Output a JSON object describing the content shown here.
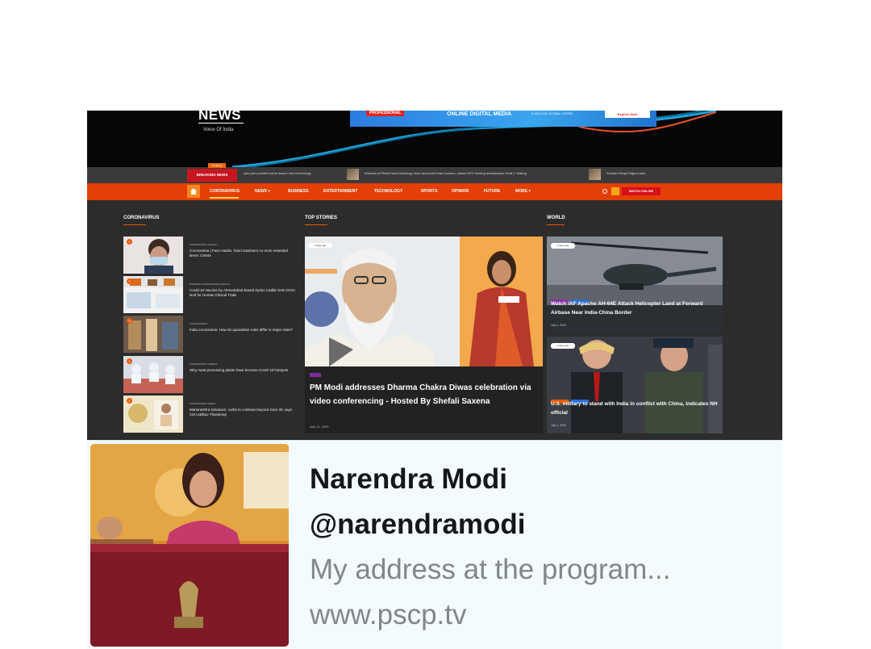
{
  "site": {
    "title": "NEWS",
    "tagline": "Voice Of India"
  },
  "ad": {
    "badge": "PROFESSIONAL",
    "headline": "ONLINE DIGITAL MEDIA",
    "sub": "5 MILLION GLOBAL USERS",
    "button": "Explore Now"
  },
  "breaking": {
    "label": "BREAKING NEWS",
    "flag": "Breaking",
    "items": [
      "ople just unveiled some insane new technology",
      "Wizards at Planet had technology more advanced than humans, claims UFO hunting ambassador Scott C Waring",
      "Sushant Singh Rajput case"
    ]
  },
  "nav": {
    "items": [
      "CORONAVIRUS",
      "NEWS ▾",
      "BUSINESS",
      "ENTERTAINMENT",
      "TECHNOLOGY",
      "SPORTS",
      "OPINION",
      "FUTURE",
      "MORE ▾"
    ],
    "watch_online": "WATCH ONLINE",
    "colors": {
      "bar": "#e43f06",
      "accent": "#ffd24a",
      "watch": "#d80f1a"
    }
  },
  "sections": {
    "coronavirus": "CORONAVIRUS",
    "top_stories": "TOP STORIES",
    "world": "WORLD"
  },
  "corona_items": [
    {
      "num": "1",
      "cats": "CORONAVIRUS   HEALTH",
      "title": "Coronavirus | Face masks, hand sanitisers no more essential items: Centre"
    },
    {
      "num": "2",
      "cats": "BUSINESS   CORONAVIRUS   HEALTH",
      "title": "Covid-19 Vaccine by Ahmedabad-based Zydus Cadila Gets DCGI Nod for Human Clinical Trials"
    },
    {
      "num": "3",
      "cats": "CORONAVIRUS",
      "title": "India coronavirus: How do quarantine rules differ in major cities?"
    },
    {
      "num": "4",
      "cats": "CORONAVIRUS   WORLD",
      "title": "Why meat processing plants have become Covid-19 hotspots"
    },
    {
      "num": "5",
      "cats": "CORONAVIRUS   NEWS",
      "title": "Maharashtra lockdown: curbs to continue beyond June 30, says CM Uddhav Thackeray"
    }
  ],
  "top_story": {
    "date_badge": "2 days ago",
    "title": "PM Modi addresses Dharma Chakra Diwas celebration via video conferencing - Hosted By Shefali Saxena",
    "date": "July 11, 2020"
  },
  "world_items": [
    {
      "date_badge": "2 days ago",
      "title": "Watch IAF Apache AH-64E Attack Helicopter Land at Forward Airbase Near India-China Border",
      "date": "July 1, 2020"
    },
    {
      "date_badge": "2 days ago",
      "title": "U.S. military to stand with India in conflict with China, indicates NH official",
      "date": "July 1, 2020"
    }
  ],
  "tweet": {
    "name": "Narendra Modi",
    "handle": "@narendramodi",
    "description": "My address at the program...",
    "link": "www.pscp.tv"
  }
}
